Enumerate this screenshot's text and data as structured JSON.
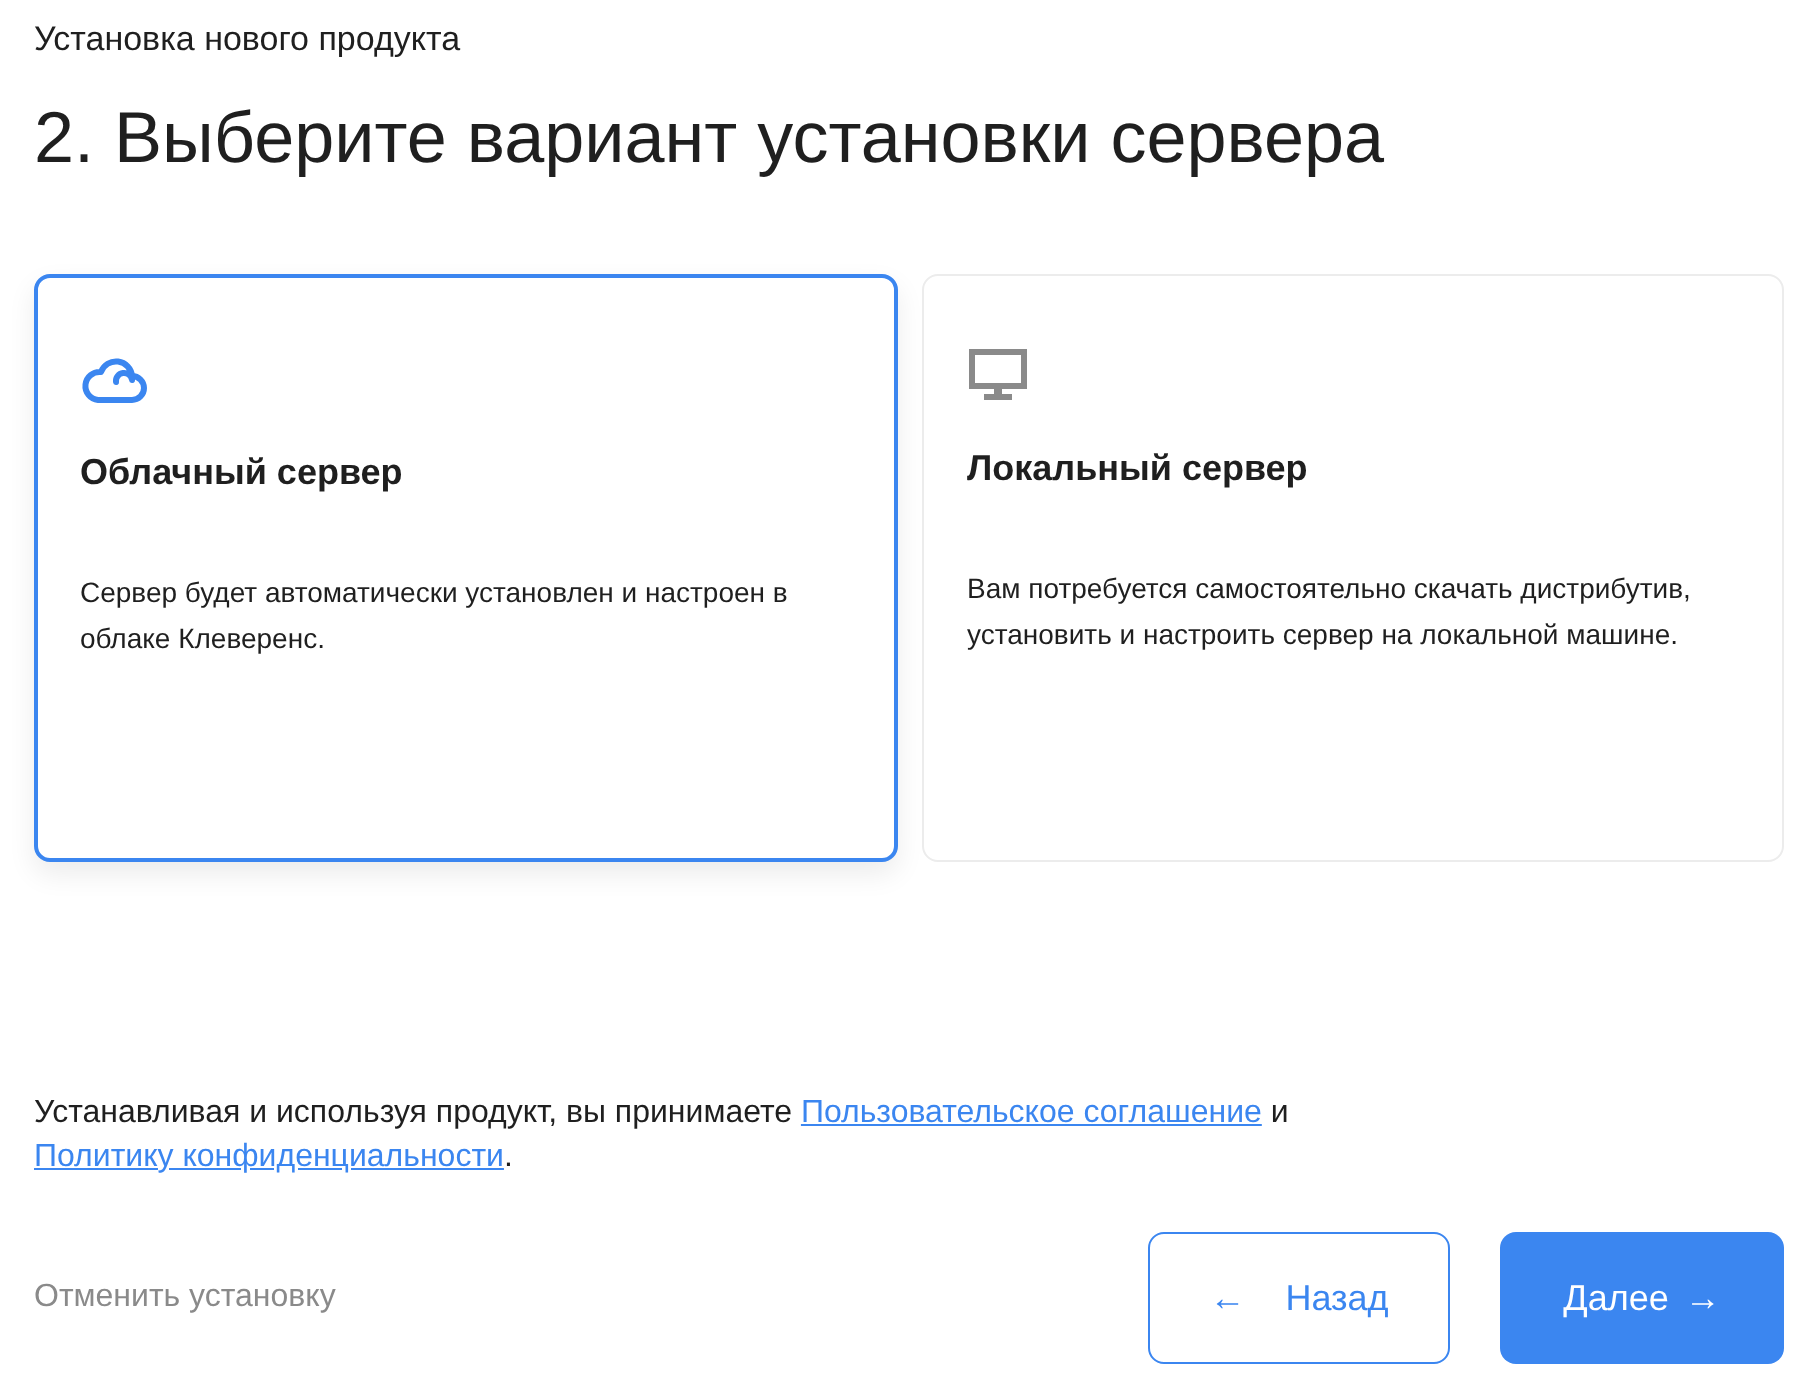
{
  "breadcrumb": "Установка нового продукта",
  "heading": "2. Выберите вариант установки сервера",
  "options": [
    {
      "kind": "cloud",
      "title": "Облачный сервер",
      "description": "Сервер будет автоматически установлен и настроен в облаке Клеверенс.",
      "selected": true
    },
    {
      "kind": "local",
      "title": "Локальный сервер",
      "description": "Вам потребуется самостоятельно скачать дистрибутив, установить и настроить сервер на локальной машине.",
      "selected": false
    }
  ],
  "consent": {
    "text": "Устанавливая и используя продукт, вы принимаете",
    "link_1": "Пользовательское соглашение",
    "joiner": "и",
    "link_2": "Политику конфиденциальности",
    "end": "."
  },
  "cancel_link": "Отменить установку",
  "back_button": {
    "icon": "←",
    "label": "Назад"
  },
  "next_button": {
    "label": "Далее",
    "icon": "→"
  }
}
